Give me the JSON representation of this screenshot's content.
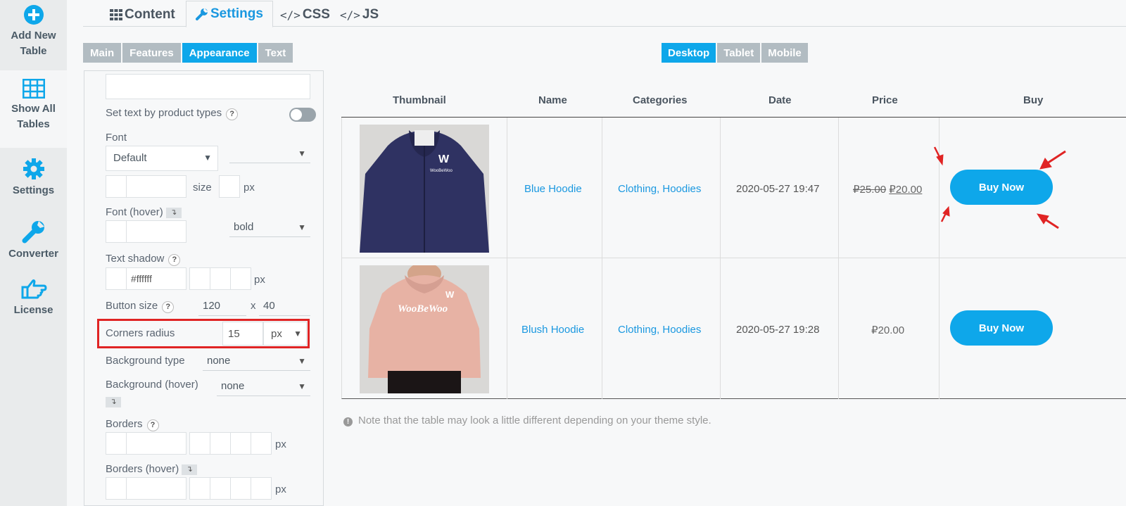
{
  "nav": {
    "add": "Add New Table",
    "show": "Show All Tables",
    "settings": "Settings",
    "converter": "Converter",
    "license": "License"
  },
  "tabs": {
    "content": "Content",
    "settings": "Settings",
    "css": "CSS",
    "js": "JS",
    "code_glyph": "</>"
  },
  "subtabs": [
    "Main",
    "Features",
    "Appearance",
    "Text"
  ],
  "devices": [
    "Desktop",
    "Tablet",
    "Mobile"
  ],
  "panel": {
    "set_text_by_type": "Set text by product types",
    "font": "Font",
    "font_default": "Default",
    "size": "size",
    "px": "px",
    "font_hover": "Font (hover)",
    "bold": "bold",
    "text_shadow": "Text shadow",
    "shadow_color": "#ffffff",
    "button_size": "Button size",
    "button_w": "120",
    "button_x": "x",
    "button_h": "40",
    "corners_radius": "Corners radius",
    "corners_value": "15",
    "corners_unit": "px",
    "bg_type": "Background type",
    "bg_type_value": "none",
    "bg_hover": "Background (hover)",
    "bg_hover_value": "none",
    "borders": "Borders",
    "borders_hover": "Borders (hover)",
    "help": "?",
    "hover_glyph": "↴"
  },
  "table": {
    "headers": [
      "Thumbnail",
      "Name",
      "Categories",
      "Date",
      "Price",
      "Buy"
    ],
    "rows": [
      {
        "name": "Blue Hoodie",
        "categories": "Clothing, Hoodies",
        "date": "2020-05-27 19:47",
        "price_old": "₽25.00",
        "price": "₽20.00",
        "buy": "Buy Now",
        "logo": "WooBeWoo"
      },
      {
        "name": "Blush Hoodie",
        "categories": "Clothing, Hoodies",
        "date": "2020-05-27 19:28",
        "price_old": "",
        "price": "₽20.00",
        "buy": "Buy Now",
        "logo": "WooBeWoo"
      }
    ],
    "note": "Note that the table may look a little different depending on your theme style."
  },
  "colors": {
    "accent": "#0ea7ea",
    "highlight": "#e02424"
  }
}
